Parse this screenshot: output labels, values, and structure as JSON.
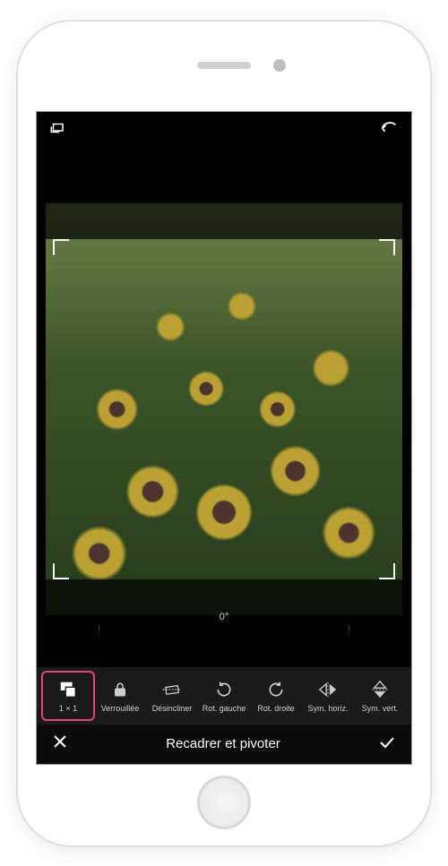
{
  "angle": {
    "value": "0°"
  },
  "toolbar": {
    "items": [
      {
        "label": "1 × 1",
        "icon": "aspect-ratio"
      },
      {
        "label": "Verrouillée",
        "icon": "lock"
      },
      {
        "label": "Désincliner",
        "icon": "straighten"
      },
      {
        "label": "Rot. gauche",
        "icon": "rotate-left"
      },
      {
        "label": "Rot. droite",
        "icon": "rotate-right"
      },
      {
        "label": "Sym. horiz.",
        "icon": "flip-horiz"
      },
      {
        "label": "Sym. vert.",
        "icon": "flip-vert"
      }
    ]
  },
  "bottomBar": {
    "title": "Recadrer et pivoter"
  }
}
